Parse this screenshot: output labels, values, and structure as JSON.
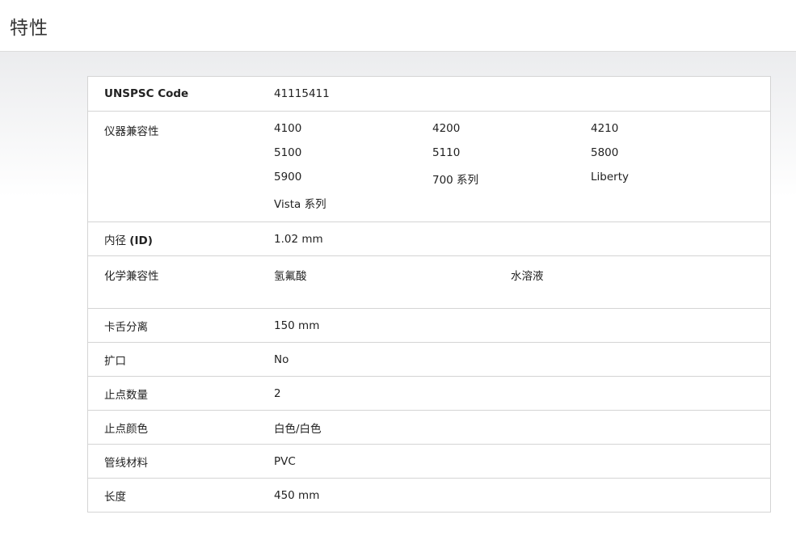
{
  "page": {
    "title": "特性"
  },
  "specs": {
    "unspsc": {
      "label": "UNSPSC Code",
      "value": "41115411"
    },
    "instrument_compat": {
      "label": "仪器兼容性",
      "items": [
        "4100",
        "4200",
        "4210",
        "5100",
        "5110",
        "5800",
        "5900",
        "700 系列",
        "Liberty",
        "Vista 系列"
      ]
    },
    "inner_diameter": {
      "label_prefix": "内径 ",
      "label_suffix": "(ID)",
      "value": "1.02 mm"
    },
    "chem_compat": {
      "label": "化学兼容性",
      "items": [
        "氢氟酸",
        "水溶液"
      ]
    },
    "clamp_separation": {
      "label": "卡舌分离",
      "value": "150 mm"
    },
    "flared": {
      "label": "扩口",
      "value": "No"
    },
    "stop_count": {
      "label": "止点数量",
      "value": "2"
    },
    "stop_color": {
      "label": "止点颜色",
      "value": "白色/白色"
    },
    "tubing_material": {
      "label": "管线材料",
      "value": "PVC"
    },
    "length": {
      "label": "长度",
      "value": "450 mm"
    }
  }
}
